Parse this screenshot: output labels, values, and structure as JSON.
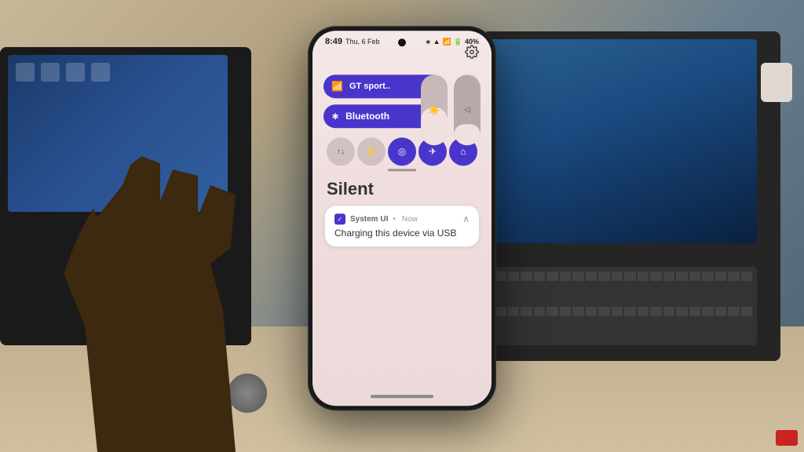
{
  "background": {
    "description": "desk scene with laptops"
  },
  "phone": {
    "status_bar": {
      "time": "8:49",
      "date": "Thu, 6 Feb",
      "battery": "40%",
      "icons": [
        "bluetooth",
        "wifi",
        "signal"
      ]
    },
    "quick_settings": {
      "wifi_tile": {
        "label": "GT sport..",
        "arrow": "›"
      },
      "bluetooth_tile": {
        "label": "Bluetooth",
        "arrow": "›"
      },
      "brightness_slider": {
        "icon": "☀",
        "level": 55
      },
      "volume_slider": {
        "icon": "◁",
        "level": 30
      },
      "toggles": [
        {
          "id": "mobile-data",
          "icon": "↑↓",
          "active": false
        },
        {
          "id": "flashlight",
          "icon": "⚡",
          "active": false
        },
        {
          "id": "location",
          "icon": "◎",
          "active": true
        },
        {
          "id": "airplane",
          "icon": "✈",
          "active": true
        },
        {
          "id": "home",
          "icon": "⌂",
          "active": true
        }
      ]
    },
    "notification_section": {
      "mode_label": "Silent",
      "notification": {
        "app_name": "System UI",
        "time": "Now",
        "message": "Charging this device via USB",
        "expand_icon": "∧"
      }
    }
  }
}
